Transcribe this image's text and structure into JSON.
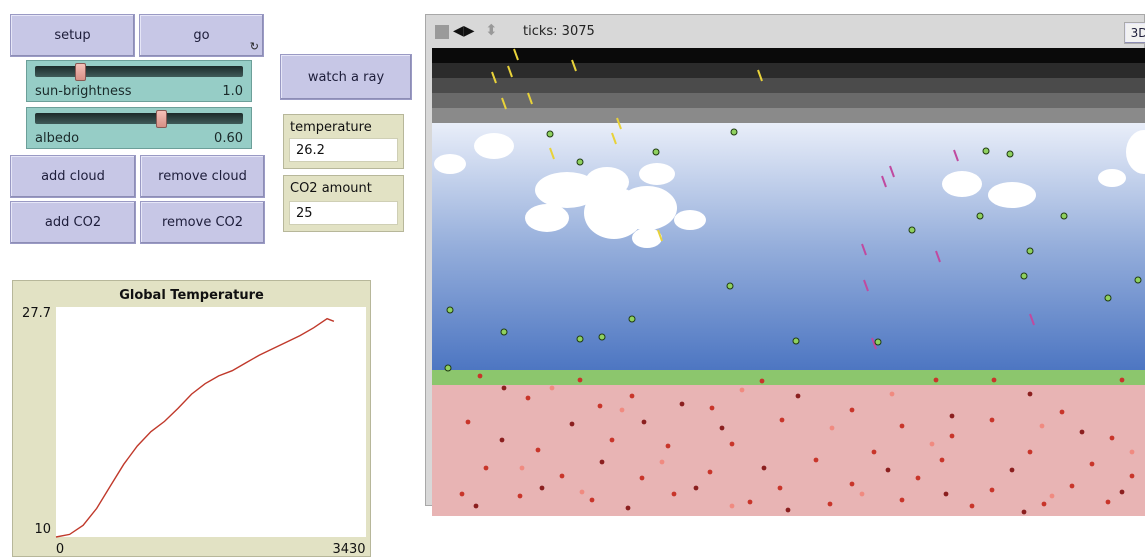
{
  "buttons": {
    "setup": "setup",
    "go": "go",
    "go_forever_icon": "↻",
    "watch_ray": "watch a ray",
    "add_cloud": "add cloud",
    "remove_cloud": "remove cloud",
    "add_co2": "add CO2",
    "remove_co2": "remove CO2"
  },
  "sliders": [
    {
      "label": "sun-brightness",
      "value": "1.0",
      "fraction": 0.2
    },
    {
      "label": "albedo",
      "value": "0.60",
      "fraction": 0.6
    }
  ],
  "monitors": {
    "temperature": {
      "label": "temperature",
      "value": "26.2"
    },
    "co2": {
      "label": "CO2 amount",
      "value": "25"
    }
  },
  "view": {
    "ticks": "ticks: 3075",
    "mode_3d": "3D"
  },
  "colors": {
    "button": "#c7c7e6",
    "slider": "#96cdc6",
    "monitor": "#e2e2c4",
    "plot_line": "#c0392b",
    "earth": "#e8b4b4",
    "grass": "#8cc66d"
  },
  "chart_data": {
    "type": "line",
    "title": "Global Temperature",
    "xlabel": "",
    "ylabel": "",
    "xlim": [
      0,
      3430
    ],
    "ylim": [
      10,
      27.7
    ],
    "x_tick_labels": [
      "0",
      "3430"
    ],
    "y_tick_labels": [
      "27.7",
      "10"
    ],
    "grid": false,
    "series": [
      {
        "x": [
          0,
          150,
          300,
          450,
          600,
          750,
          900,
          1050,
          1200,
          1350,
          1500,
          1650,
          1800,
          1950,
          2100,
          2250,
          2400,
          2550,
          2700,
          2850,
          3000,
          3075
        ],
        "y": [
          10.0,
          10.2,
          10.9,
          12.2,
          13.9,
          15.6,
          17.0,
          18.1,
          18.9,
          19.9,
          21.0,
          21.8,
          22.4,
          22.8,
          23.4,
          24.0,
          24.5,
          25.0,
          25.5,
          26.1,
          26.8,
          26.6
        ]
      }
    ]
  }
}
